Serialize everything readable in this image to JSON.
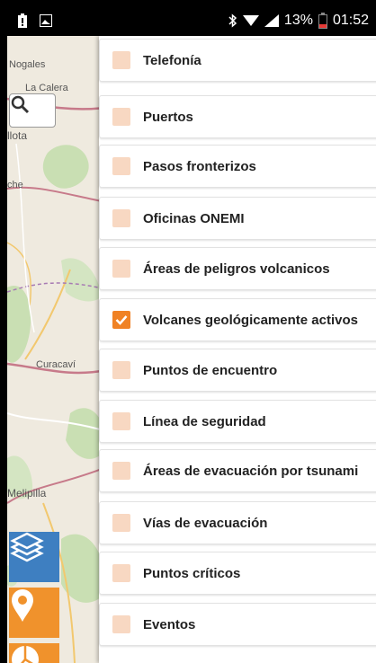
{
  "status_bar": {
    "battery_percent": "13%",
    "time": "01:52"
  },
  "map": {
    "labels": [
      "Nogales",
      "La Calera",
      "llota",
      "che",
      "Curacaví",
      "Melipilla"
    ]
  },
  "layers": [
    {
      "label": "Telefonía",
      "checked": false
    },
    {
      "label": "Puertos",
      "checked": false
    },
    {
      "label": "Pasos fronterizos",
      "checked": false
    },
    {
      "label": "Oficinas ONEMI",
      "checked": false
    },
    {
      "label": "Áreas de peligros volcanicos",
      "checked": false
    },
    {
      "label": "Volcanes geológicamente activos",
      "checked": true
    },
    {
      "label": "Puntos de encuentro",
      "checked": false
    },
    {
      "label": "Línea de seguridad",
      "checked": false
    },
    {
      "label": "Áreas de evacuación por tsunami",
      "checked": false
    },
    {
      "label": "Vías de evacuación",
      "checked": false
    },
    {
      "label": "Puntos críticos",
      "checked": false
    },
    {
      "label": "Eventos",
      "checked": false
    }
  ],
  "colors": {
    "checkbox_checked": "#f08224",
    "checkbox_unchecked": "#f8d8c2",
    "layers_button": "#3e7fc1",
    "action_buttons": "#f0922c"
  }
}
